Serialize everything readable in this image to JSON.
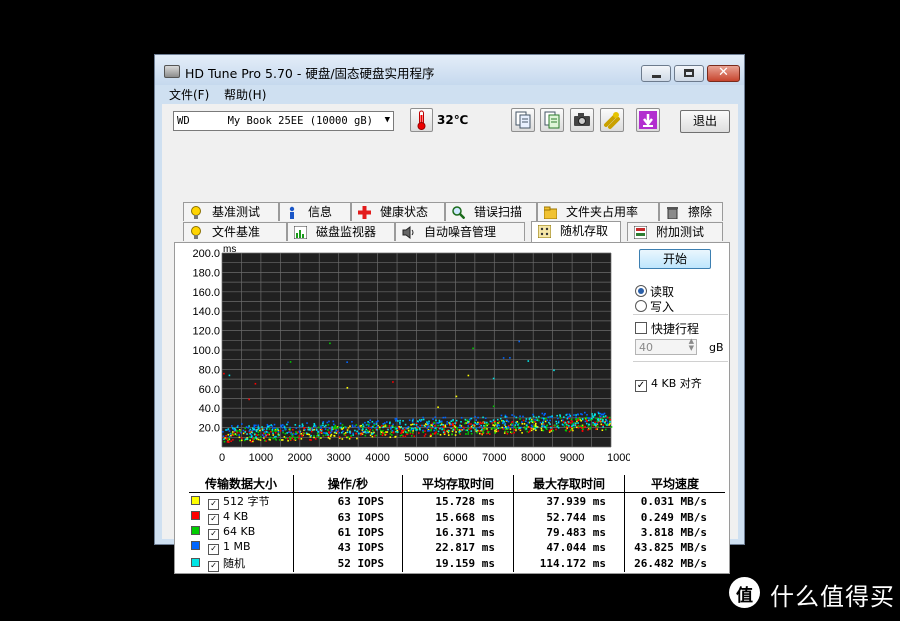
{
  "window": {
    "title": "HD Tune Pro 5.70 - 硬盘/固态硬盘实用程序"
  },
  "menu": [
    {
      "label": "文件(F)"
    },
    {
      "label": "帮助(H)"
    }
  ],
  "toolbar": {
    "drive": "WD      My Book 25EE (10000 gB)",
    "temperature": "32℃",
    "exit_label": "退出"
  },
  "tabs_row1": [
    {
      "label": "基准测试",
      "icon": "benchmark-icon"
    },
    {
      "label": "信息",
      "icon": "info-icon"
    },
    {
      "label": "健康状态",
      "icon": "health-icon"
    },
    {
      "label": "错误扫描",
      "icon": "error-scan-icon"
    },
    {
      "label": "文件夹占用率",
      "icon": "folder-icon"
    },
    {
      "label": "擦除",
      "icon": "erase-icon"
    }
  ],
  "tabs_row2": [
    {
      "label": "文件基准",
      "icon": "file-benchmark-icon"
    },
    {
      "label": "磁盘监视器",
      "icon": "disk-monitor-icon"
    },
    {
      "label": "自动噪音管理",
      "icon": "noise-icon"
    },
    {
      "label": "随机存取",
      "icon": "random-access-icon",
      "active": true
    },
    {
      "label": "附加测试",
      "icon": "extra-tests-icon"
    }
  ],
  "controls": {
    "start_label": "开始",
    "read_label": "读取",
    "write_label": "写入",
    "mode": "read",
    "short_stroke_label": "快捷行程",
    "short_stroke_checked": false,
    "short_stroke_value": "40",
    "short_stroke_unit": "gB",
    "align_label": "4 KB 对齐",
    "align_checked": true
  },
  "colors": {
    "512": "#ffff00",
    "4k": "#ff0000",
    "64k": "#00cc00",
    "1m": "#0066ff",
    "random": "#00e5e5",
    "plot_bg": "#202020",
    "grid": "#6b6b6b"
  },
  "chart_data": {
    "type": "scatter",
    "ylabel": "ms",
    "xunit": "gB",
    "ylim": [
      0,
      200
    ],
    "xlim": [
      0,
      10000
    ],
    "yticks": [
      "200.0",
      "180.0",
      "160.0",
      "140.0",
      "120.0",
      "100.0",
      "80.0",
      "60.0",
      "40.0",
      "20.0"
    ],
    "xticks": [
      "0",
      "1000",
      "2000",
      "3000",
      "4000",
      "5000",
      "6000",
      "7000",
      "8000",
      "9000",
      "10000gB"
    ],
    "grid": true,
    "note": "dense band of access times rising from about 5–20 ms at 0 gB to about 20–35 ms at 10000 gB, with sparse outliers up to ~115 ms",
    "series": [
      {
        "name": "512 字节",
        "color": "#ffff00",
        "band_start": [
          5,
          18
        ],
        "band_end": [
          18,
          32
        ]
      },
      {
        "name": "4 KB",
        "color": "#ff0000",
        "band_start": [
          5,
          18
        ],
        "band_end": [
          18,
          32
        ]
      },
      {
        "name": "64 KB",
        "color": "#00cc00",
        "band_start": [
          6,
          20
        ],
        "band_end": [
          19,
          34
        ]
      },
      {
        "name": "1 MB",
        "color": "#0066ff",
        "band_start": [
          10,
          24
        ],
        "band_end": [
          24,
          38
        ]
      },
      {
        "name": "随机",
        "color": "#00e5e5",
        "band_start": [
          8,
          22
        ],
        "band_end": [
          22,
          36
        ]
      }
    ]
  },
  "results": {
    "headers": [
      "传输数据大小",
      "操作/秒",
      "平均存取时间",
      "最大存取时间",
      "平均速度"
    ],
    "rows": [
      {
        "size": "512 字节",
        "swatch": "#ffff00",
        "ops": "63 IOPS",
        "avg": "15.728 ms",
        "max": "37.939 ms",
        "speed": "0.031 MB/s"
      },
      {
        "size": "4 KB",
        "swatch": "#ff0000",
        "ops": "63 IOPS",
        "avg": "15.668 ms",
        "max": "52.744 ms",
        "speed": "0.249 MB/s"
      },
      {
        "size": "64 KB",
        "swatch": "#00cc00",
        "ops": "61 IOPS",
        "avg": "16.371 ms",
        "max": "79.483 ms",
        "speed": "3.818 MB/s"
      },
      {
        "size": "1 MB",
        "swatch": "#0066ff",
        "ops": "43 IOPS",
        "avg": "22.817 ms",
        "max": "47.044 ms",
        "speed": "43.825 MB/s"
      },
      {
        "size": "随机",
        "swatch": "#00e5e5",
        "ops": "52 IOPS",
        "avg": "19.159 ms",
        "max": "114.172 ms",
        "speed": "26.482 MB/s"
      }
    ]
  },
  "watermark": {
    "text": "什么值得买",
    "logo": "值"
  }
}
